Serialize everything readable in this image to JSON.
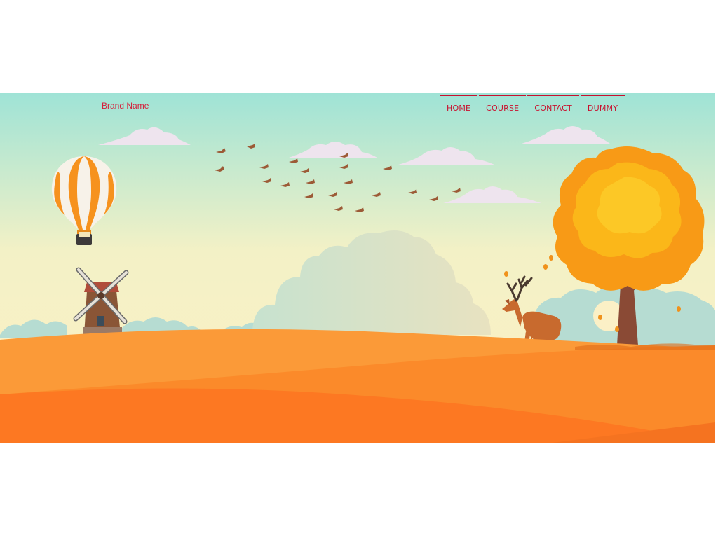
{
  "header": {
    "brand": "Brand Name",
    "nav": [
      {
        "label": "HOME"
      },
      {
        "label": "COURSE"
      },
      {
        "label": "CONTACT"
      },
      {
        "label": "DUMMY"
      }
    ]
  },
  "colors": {
    "accent": "#c8102e",
    "sky_top": "#9fe3d6",
    "sky_bottom": "#fdf2c4",
    "hill_orange": "#fb8a2a",
    "foliage": "#fbb719"
  },
  "illustration": {
    "elements": [
      "hot-air-balloon",
      "windmill",
      "flock-of-birds",
      "clouds",
      "deer",
      "autumn-tree",
      "orange-hills"
    ]
  }
}
